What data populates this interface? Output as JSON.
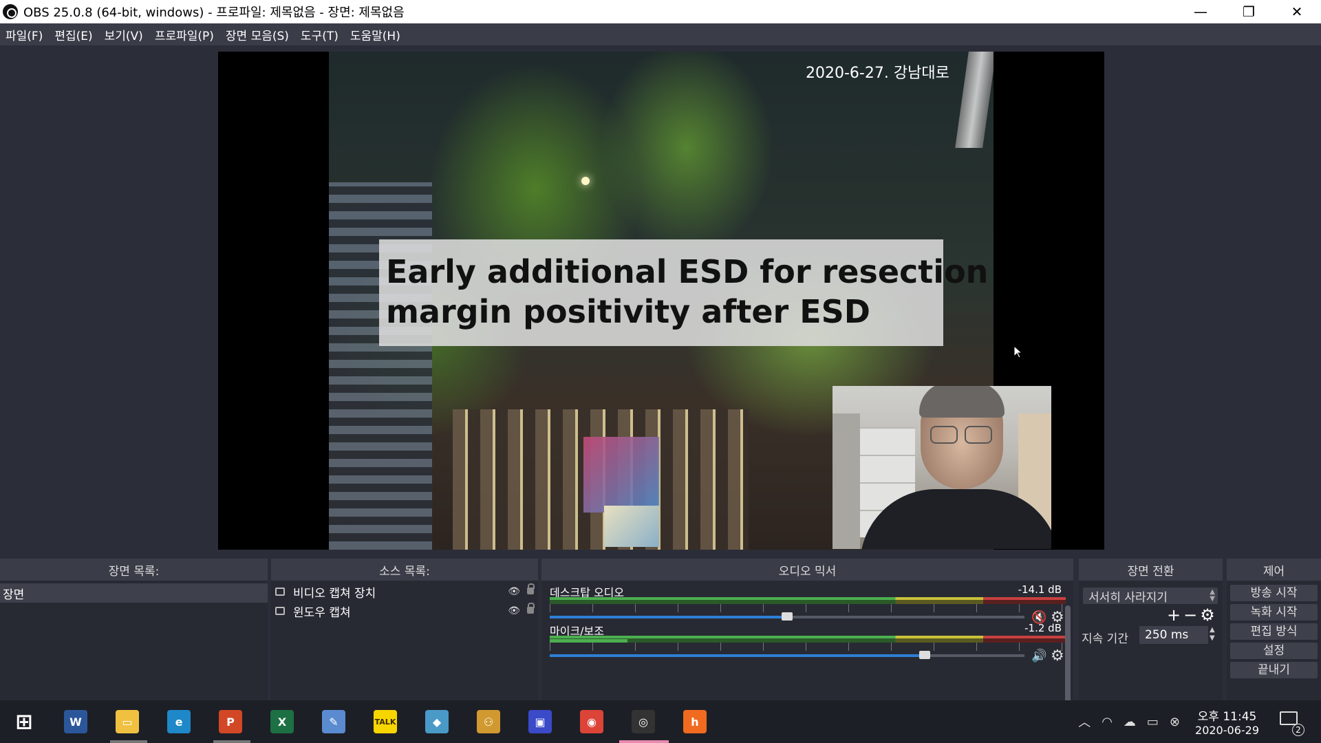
{
  "window": {
    "title": "OBS 25.0.8 (64-bit, windows) - 프로파일: 제목없음 - 장면: 제목없음",
    "minimize": "—",
    "restore": "❐",
    "close": "✕"
  },
  "menu": [
    "파일(F)",
    "편집(E)",
    "보기(V)",
    "프로파일(P)",
    "장면 모음(S)",
    "도구(T)",
    "도움말(H)"
  ],
  "preview": {
    "date_caption": "2020-6-27. 강남대로",
    "title_line1": "Early additional ESD for resection",
    "title_line2": "margin positivity after ESD"
  },
  "scenes": {
    "header": "장면 목록:",
    "items": [
      "장면"
    ]
  },
  "sources": {
    "header": "소스 목록:",
    "items": [
      {
        "label": "비디오 캡쳐 장치",
        "icon": "camera-icon"
      },
      {
        "label": "윈도우 캡쳐",
        "icon": "window-icon"
      }
    ]
  },
  "mixer": {
    "header": "오디오 믹서",
    "channels": [
      {
        "name": "데스크탑 오디오",
        "db": "-14.1 dB",
        "level": 0.0,
        "volume": 0.5,
        "muted": true
      },
      {
        "name": "마이크/보조",
        "db": "-1.2 dB",
        "level": 0.15,
        "volume": 0.79,
        "muted": false
      }
    ]
  },
  "transitions": {
    "header": "장면 전환",
    "selected": "서서히 사라지기",
    "duration_label": "지속 기간",
    "duration_value": "250 ms"
  },
  "controls": {
    "header": "제어",
    "buttons": [
      "방송 시작",
      "녹화 시작",
      "편집 방식",
      "설정",
      "끝내기"
    ]
  },
  "taskbar": {
    "apps": [
      {
        "name": "windows-start-icon",
        "label": "⊞",
        "color": "#1d1f26"
      },
      {
        "name": "word-icon",
        "label": "W",
        "color": "#2b579a"
      },
      {
        "name": "file-explorer-icon",
        "label": "▭",
        "color": "#f0c040"
      },
      {
        "name": "edge-icon",
        "label": "e",
        "color": "#1e88c8"
      },
      {
        "name": "powerpoint-icon",
        "label": "P",
        "color": "#d24726"
      },
      {
        "name": "excel-icon",
        "label": "X",
        "color": "#1d7044"
      },
      {
        "name": "paint-icon",
        "label": "✎",
        "color": "#5a8ad0"
      },
      {
        "name": "kakaotalk-icon",
        "label": "TALK",
        "color": "#f7d600"
      },
      {
        "name": "notes-icon",
        "label": "◆",
        "color": "#4a9ac8"
      },
      {
        "name": "people-icon",
        "label": "⚇",
        "color": "#d09a30"
      },
      {
        "name": "save-app-icon",
        "label": "▣",
        "color": "#3a4ac8"
      },
      {
        "name": "chrome-icon",
        "label": "◉",
        "color": "#db4437"
      },
      {
        "name": "obs-icon",
        "label": "◎",
        "color": "#333"
      },
      {
        "name": "hangouts-icon",
        "label": "h",
        "color": "#f06a20"
      }
    ],
    "clock_time": "오후 11:45",
    "clock_date": "2020-06-29",
    "notification_count": "2"
  },
  "colors": {
    "accent_volume": "#2e7fd6",
    "meter_green": "#4caf50",
    "meter_yellow": "#c9c23a",
    "meter_red": "#c84040",
    "mute_red": "#e03030"
  }
}
